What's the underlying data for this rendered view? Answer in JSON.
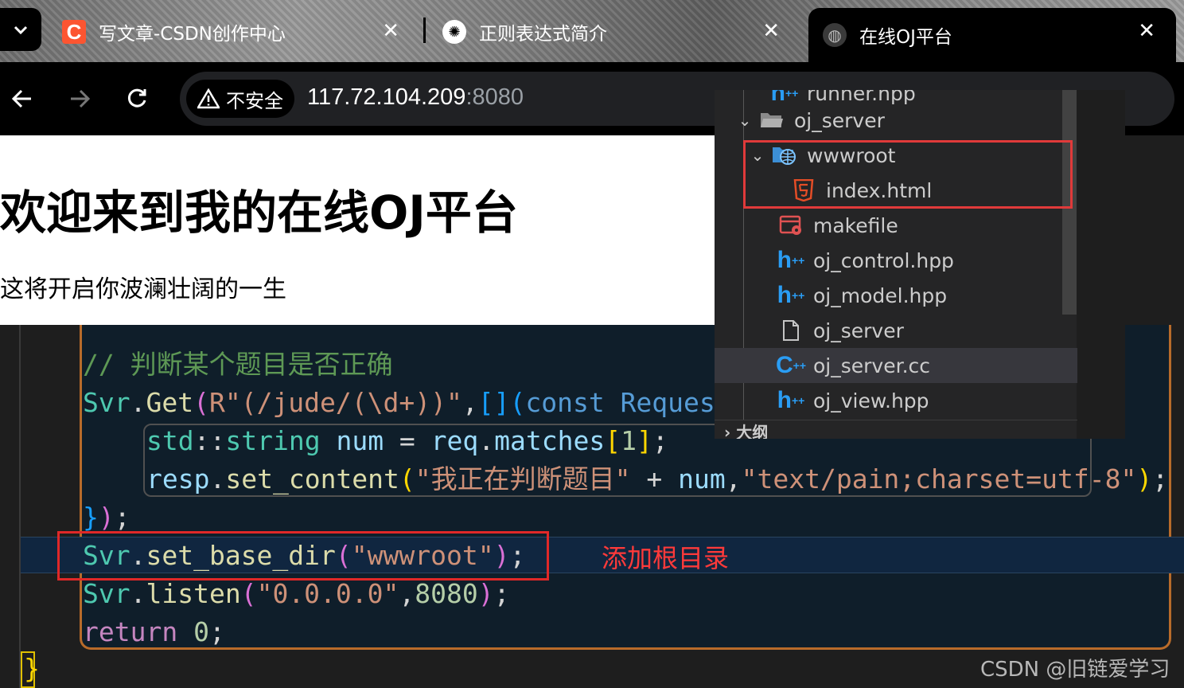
{
  "browser": {
    "tabs": [
      {
        "title": "写文章-CSDN创作中心",
        "icon": "csdn-logo"
      },
      {
        "title": "正则表达式简介",
        "icon": "openai-logo"
      },
      {
        "title": "在线OJ平台",
        "icon": "globe-icon"
      }
    ],
    "close_glyph": "✕",
    "insecure_label": "不安全",
    "url_host": "117.72.104.209",
    "url_port": ":8080"
  },
  "page": {
    "heading": "欢迎来到我的在线OJ平台",
    "paragraph": "这将开启你波澜壮阔的一生"
  },
  "explorer": {
    "items": [
      {
        "label": "runner.hpp",
        "icon": "cpp-header-icon",
        "chevron": ""
      },
      {
        "label": "oj_server",
        "icon": "folder-open-icon",
        "chevron": "⌄"
      },
      {
        "label": "wwwroot",
        "icon": "web-folder-icon",
        "chevron": "⌄"
      },
      {
        "label": "index.html",
        "icon": "html5-icon",
        "chevron": ""
      },
      {
        "label": "makefile",
        "icon": "makefile-icon",
        "chevron": ""
      },
      {
        "label": "oj_control.hpp",
        "icon": "cpp-header-icon",
        "chevron": ""
      },
      {
        "label": "oj_model.hpp",
        "icon": "cpp-header-icon",
        "chevron": ""
      },
      {
        "label": "oj_server",
        "icon": "file-icon",
        "chevron": ""
      },
      {
        "label": "oj_server.cc",
        "icon": "cpp-source-icon",
        "chevron": ""
      },
      {
        "label": "oj_view.hpp",
        "icon": "cpp-header-icon",
        "chevron": ""
      }
    ],
    "outline_label": "大纲"
  },
  "code": {
    "comment": "// 判断某个题目是否正确",
    "get_regex": "R\"(/jude/(\\d+))\"",
    "lambda_tail": "const Reques",
    "str_type": "string",
    "num_var": "num",
    "matches_idx": "1",
    "content_str": "\"我正在判断题目\"",
    "mime_str": "\"text/pain;charset=utf-8\"",
    "base_dir_str": "\"wwwroot\"",
    "listen_ip": "\"0.0.0.0\"",
    "listen_port": "8080",
    "return_val": "0"
  },
  "annotation": "添加根目录",
  "watermark": "CSDN @旧链爱学习",
  "colors": {
    "annotation_red": "#e02828",
    "csdn_orange": "#fc5531",
    "block_border": "#b86b2a"
  }
}
